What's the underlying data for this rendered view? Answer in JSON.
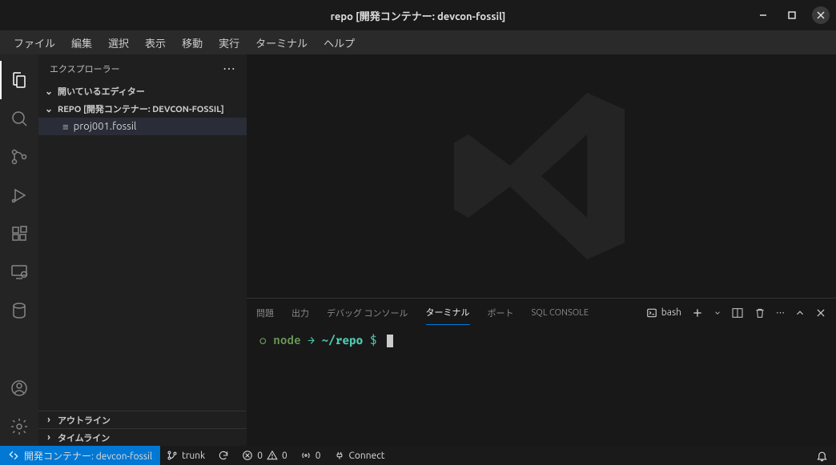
{
  "window": {
    "title": "repo [開発コンテナー: devcon-fossil]"
  },
  "menubar": [
    "ファイル",
    "編集",
    "選択",
    "表示",
    "移動",
    "実行",
    "ターミナル",
    "ヘルプ"
  ],
  "sidebar": {
    "title": "エクスプローラー",
    "sections": {
      "open_editors": "開いているエディター",
      "repo": "REPO [開発コンテナー: DEVCON-FOSSIL]",
      "outline": "アウトライン",
      "timeline": "タイムライン"
    },
    "files": [
      {
        "name": "proj001.fossil"
      }
    ]
  },
  "panel": {
    "tabs": {
      "problems": "問題",
      "output": "出力",
      "debug_console": "デバッグ コンソール",
      "terminal": "ターミナル",
      "ports": "ポート",
      "sql_console": "SQL CONSOLE"
    },
    "terminal_kind": "bash",
    "terminal": {
      "node_label": "node",
      "arrow": "→",
      "path_prefix": "~/",
      "path_repo": "repo",
      "prompt": "$"
    }
  },
  "statusbar": {
    "remote": "開発コンテナー: devcon-fossil",
    "branch": "trunk",
    "errors": "0",
    "warnings": "0",
    "ports": "0",
    "connect": "Connect"
  }
}
